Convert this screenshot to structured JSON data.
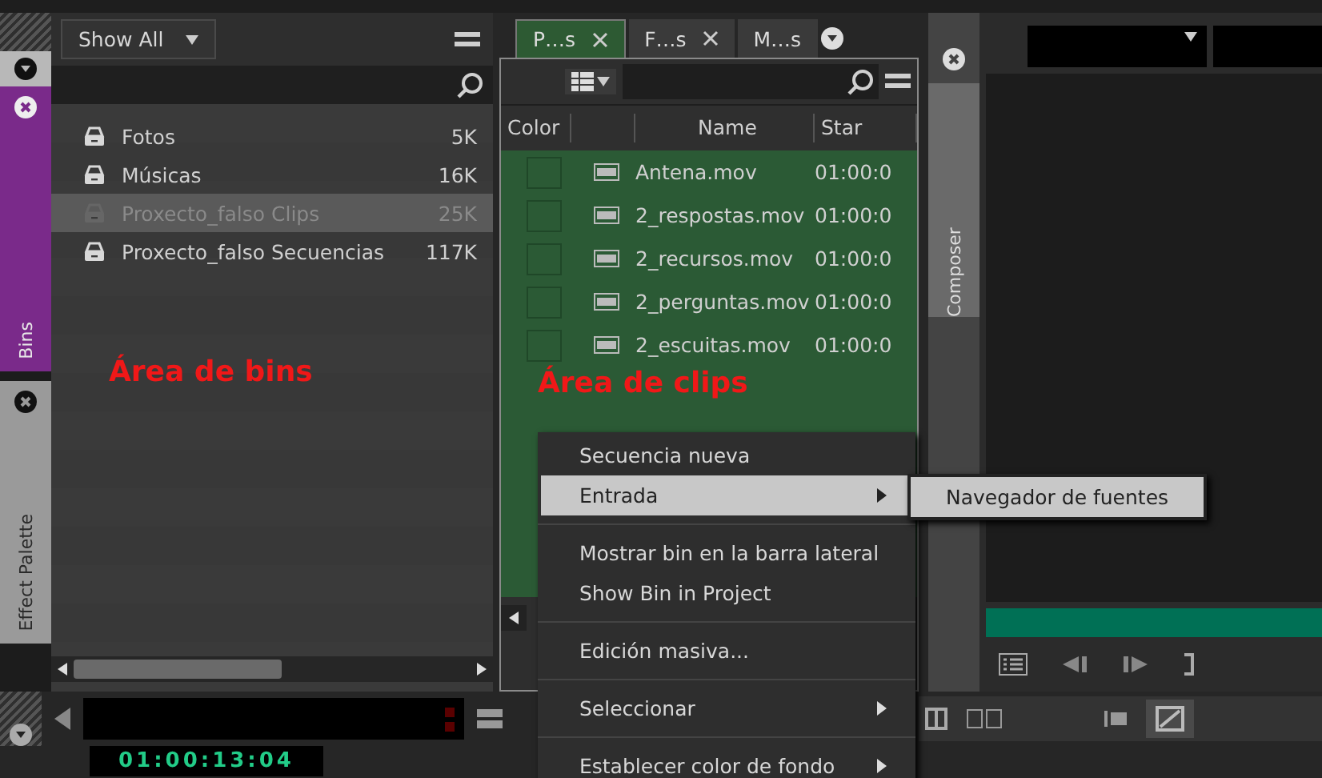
{
  "side_tabs": [
    {
      "label": "Bins",
      "selected": true
    },
    {
      "label": "Effect Palette",
      "selected": false
    }
  ],
  "bins": {
    "filter": "Show All",
    "items": [
      {
        "name": "Fotos",
        "size": "5K",
        "selected": false
      },
      {
        "name": "Músicas",
        "size": "16K",
        "selected": false
      },
      {
        "name": "Proxecto_falso Clips",
        "size": "25K",
        "selected": true
      },
      {
        "name": "Proxecto_falso Secuencias",
        "size": "117K",
        "selected": false
      }
    ],
    "annotation": "Área de bins"
  },
  "clips": {
    "tabs": [
      {
        "label": "P…s",
        "selected": true
      },
      {
        "label": "F…s",
        "selected": false
      },
      {
        "label": "M…s",
        "selected": false
      }
    ],
    "columns": [
      "Color",
      "Name",
      "Star"
    ],
    "rows": [
      {
        "name": "Antena.mov",
        "start": "01:00:0"
      },
      {
        "name": "2_respostas.mov",
        "start": "01:00:0"
      },
      {
        "name": "2_recursos.mov",
        "start": "01:00:0"
      },
      {
        "name": "2_perguntas.mov",
        "start": "01:00:0"
      },
      {
        "name": "2_escuitas.mov",
        "start": "01:00:0"
      }
    ],
    "annotation": "Área de clips"
  },
  "composer": {
    "label": "Composer"
  },
  "context_menu": {
    "items": [
      {
        "kind": "item",
        "label": "Secuencia nueva",
        "selected": false,
        "has_submenu": false
      },
      {
        "kind": "item",
        "label": "Entrada",
        "selected": true,
        "has_submenu": true
      },
      {
        "kind": "separator"
      },
      {
        "kind": "item",
        "label": "Mostrar bin en la barra lateral",
        "selected": false,
        "has_submenu": false
      },
      {
        "kind": "item",
        "label": "Show Bin in Project",
        "selected": false,
        "has_submenu": false
      },
      {
        "kind": "separator"
      },
      {
        "kind": "item",
        "label": "Edición masiva...",
        "selected": false,
        "has_submenu": false
      },
      {
        "kind": "separator"
      },
      {
        "kind": "item",
        "label": "Seleccionar",
        "selected": false,
        "has_submenu": true
      },
      {
        "kind": "separator"
      },
      {
        "kind": "item",
        "label": "Establecer color de fondo",
        "selected": false,
        "has_submenu": true
      }
    ]
  },
  "submenu": {
    "items": [
      "Navegador de fuentes"
    ]
  },
  "timecode": "01:00:13:04"
}
